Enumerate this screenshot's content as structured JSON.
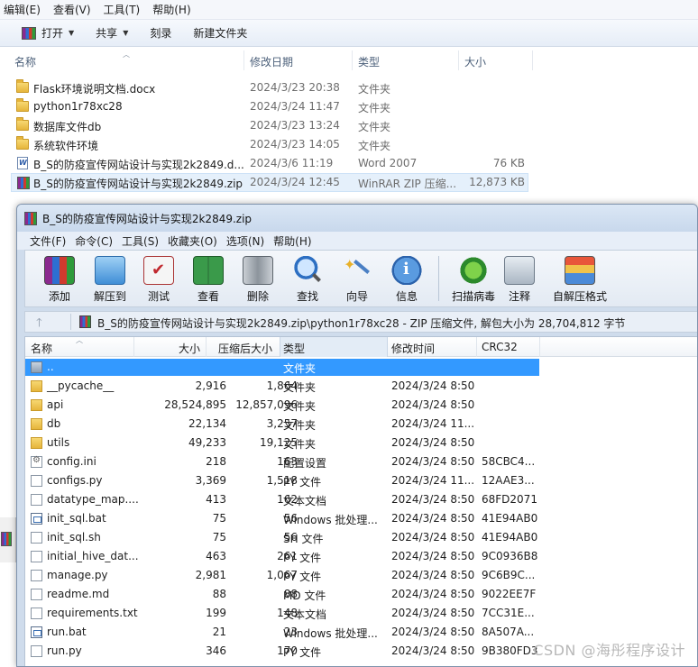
{
  "explorer": {
    "menu": [
      "编辑(E)",
      "查看(V)",
      "工具(T)",
      "帮助(H)"
    ],
    "toolbar": {
      "open": "打开",
      "share": "共享",
      "burn": "刻录",
      "new_folder": "新建文件夹"
    },
    "columns": {
      "name": "名称",
      "modified": "修改日期",
      "type": "类型",
      "size": "大小"
    },
    "files": [
      {
        "icon": "folder-icon",
        "name": "Flask环境说明文档.docx",
        "modified": "2024/3/23 20:38",
        "type": "文件夹",
        "size": ""
      },
      {
        "icon": "folder-icon",
        "name": "python1r78xc28",
        "modified": "2024/3/24 11:47",
        "type": "文件夹",
        "size": ""
      },
      {
        "icon": "folder-icon",
        "name": "数据库文件db",
        "modified": "2024/3/23 13:24",
        "type": "文件夹",
        "size": ""
      },
      {
        "icon": "folder-icon",
        "name": "系统软件环境",
        "modified": "2024/3/23 14:05",
        "type": "文件夹",
        "size": ""
      },
      {
        "icon": "word-document-icon",
        "name": "B_S的防疫宣传网站设计与实现2k2849.d...",
        "modified": "2024/3/6 11:19",
        "type": "Word 2007",
        "size": "76 KB"
      },
      {
        "icon": "winrar-archive-icon",
        "name": "B_S的防疫宣传网站设计与实现2k2849.zip",
        "modified": "2024/3/24 12:45",
        "type": "WinRAR ZIP 压缩...",
        "size": "12,873 KB"
      }
    ]
  },
  "winrar": {
    "title": "B_S的防疫宣传网站设计与实现2k2849.zip",
    "menu": [
      "文件(F)",
      "命令(C)",
      "工具(S)",
      "收藏夹(O)",
      "选项(N)",
      "帮助(H)"
    ],
    "toolbar": {
      "add": "添加",
      "extract": "解压到",
      "test": "测试",
      "view": "查看",
      "delete": "删除",
      "find": "查找",
      "wizard": "向导",
      "info": "信息",
      "virus_scan": "扫描病毒",
      "comment": "注释",
      "sfx": "自解压格式"
    },
    "address": "B_S的防疫宣传网站设计与实现2k2849.zip\\python1r78xc28 - ZIP 压缩文件, 解包大小为 28,704,812 字节",
    "columns": {
      "name": "名称",
      "size": "大小",
      "packed": "压缩后大小",
      "type": "类型",
      "modified": "修改时间",
      "crc": "CRC32"
    },
    "rows": [
      {
        "icon": "up",
        "name": "..",
        "size": "",
        "packed": "",
        "type": "文件夹",
        "modified": "",
        "crc": ""
      },
      {
        "icon": "folder",
        "name": "__pycache__",
        "size": "2,916",
        "packed": "1,864",
        "type": "文件夹",
        "modified": "2024/3/24 8:50",
        "crc": ""
      },
      {
        "icon": "folder",
        "name": "api",
        "size": "28,524,895",
        "packed": "12,857,096",
        "type": "文件夹",
        "modified": "2024/3/24 8:50",
        "crc": ""
      },
      {
        "icon": "folder",
        "name": "db",
        "size": "22,134",
        "packed": "3,257",
        "type": "文件夹",
        "modified": "2024/3/24 11...",
        "crc": ""
      },
      {
        "icon": "folder",
        "name": "utils",
        "size": "49,233",
        "packed": "19,125",
        "type": "文件夹",
        "modified": "2024/3/24 8:50",
        "crc": ""
      },
      {
        "icon": "gear",
        "name": "config.ini",
        "size": "218",
        "packed": "163",
        "type": "配置设置",
        "modified": "2024/3/24 8:50",
        "crc": "58CBC4..."
      },
      {
        "icon": "file",
        "name": "configs.py",
        "size": "3,369",
        "packed": "1,518",
        "type": "PY 文件",
        "modified": "2024/3/24 11...",
        "crc": "12AAE3..."
      },
      {
        "icon": "file",
        "name": "datatype_map....",
        "size": "413",
        "packed": "162",
        "type": "文本文档",
        "modified": "2024/3/24 8:50",
        "crc": "68FD2071"
      },
      {
        "icon": "bat",
        "name": "init_sql.bat",
        "size": "75",
        "packed": "56",
        "type": "Windows 批处理...",
        "modified": "2024/3/24 8:50",
        "crc": "41E94AB0"
      },
      {
        "icon": "file",
        "name": "init_sql.sh",
        "size": "75",
        "packed": "56",
        "type": "SH 文件",
        "modified": "2024/3/24 8:50",
        "crc": "41E94AB0"
      },
      {
        "icon": "file",
        "name": "initial_hive_dat...",
        "size": "463",
        "packed": "261",
        "type": "PY 文件",
        "modified": "2024/3/24 8:50",
        "crc": "9C0936B8"
      },
      {
        "icon": "file",
        "name": "manage.py",
        "size": "2,981",
        "packed": "1,067",
        "type": "PY 文件",
        "modified": "2024/3/24 8:50",
        "crc": "9C6B9C..."
      },
      {
        "icon": "file",
        "name": "readme.md",
        "size": "88",
        "packed": "88",
        "type": "MD 文件",
        "modified": "2024/3/24 8:50",
        "crc": "9022EE7F"
      },
      {
        "icon": "file",
        "name": "requirements.txt",
        "size": "199",
        "packed": "148",
        "type": "文本文档",
        "modified": "2024/3/24 8:50",
        "crc": "7CC31E..."
      },
      {
        "icon": "bat",
        "name": "run.bat",
        "size": "21",
        "packed": "23",
        "type": "Windows 批处理...",
        "modified": "2024/3/24 8:50",
        "crc": "8A507A..."
      },
      {
        "icon": "file",
        "name": "run.py",
        "size": "346",
        "packed": "170",
        "type": "PY 文件",
        "modified": "2024/3/24 8:50",
        "crc": "9B380FD3"
      }
    ]
  },
  "watermark": "CSDN @海彤程序设计"
}
